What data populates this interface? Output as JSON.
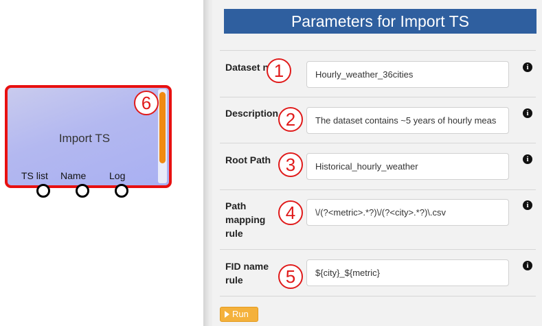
{
  "node": {
    "title": "Import TS",
    "ports": [
      "TS list",
      "Name",
      "Log"
    ],
    "accent_border": "#e81010",
    "scroll_color": "#f08a12"
  },
  "badges": [
    "1",
    "2",
    "3",
    "4",
    "5",
    "6"
  ],
  "panel": {
    "title": "Parameters for Import TS",
    "header_color": "#2f5f9f",
    "fields": [
      {
        "label": "Dataset name",
        "value": "Hourly_weather_36cities",
        "info_icon": "info-circle-icon"
      },
      {
        "label": "Description",
        "value": "The dataset contains ~5 years of hourly meas",
        "info_icon": "info-circle-icon"
      },
      {
        "label": "Root Path",
        "value": "Historical_hourly_weather",
        "info_icon": "info-circle-icon"
      },
      {
        "label": "Path mapping rule",
        "value": "\\/(?<metric>.*?)\\/(?<city>.*?)\\.csv",
        "info_icon": "info-circle-icon"
      },
      {
        "label": "FID name rule",
        "value": "${city}_${metric}",
        "info_icon": "info-circle-icon"
      }
    ],
    "run_label": "Run",
    "run_color": "#f4b13c"
  }
}
